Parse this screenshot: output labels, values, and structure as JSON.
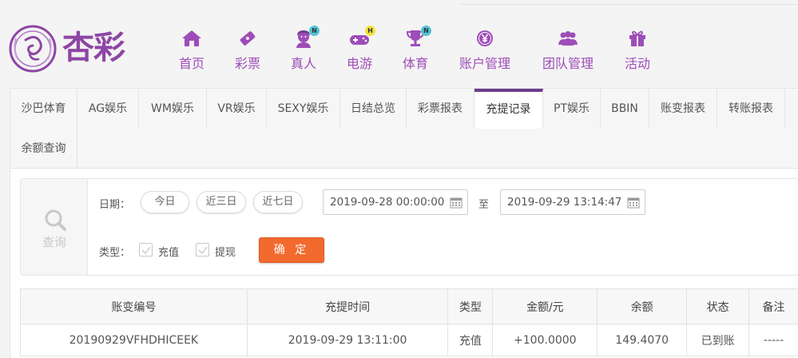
{
  "brand": {
    "name": "杏彩",
    "color": "#8e46a5"
  },
  "nav": [
    {
      "label": "首页",
      "icon": "home-icon"
    },
    {
      "label": "彩票",
      "icon": "ticket-icon"
    },
    {
      "label": "真人",
      "icon": "live-dealer-icon",
      "badge": "N"
    },
    {
      "label": "电游",
      "icon": "gamepad-icon",
      "badge": "H"
    },
    {
      "label": "体育",
      "icon": "trophy-icon",
      "badge": "N"
    },
    {
      "label": "账户管理",
      "icon": "yen-coin-icon"
    },
    {
      "label": "团队管理",
      "icon": "team-icon"
    },
    {
      "label": "活动",
      "icon": "gift-icon"
    }
  ],
  "tabs": [
    "沙巴体育",
    "AG娱乐",
    "WM娱乐",
    "VR娱乐",
    "SEXY娱乐",
    "日结总览",
    "彩票报表",
    "充提记录",
    "PT娱乐",
    "BBIN",
    "账变报表",
    "转账报表",
    "余额查询"
  ],
  "active_tab": "充提记录",
  "filter": {
    "side_label": "查询",
    "date_label": "日期：",
    "quick_ranges": [
      "今日",
      "近三日",
      "近七日"
    ],
    "start_date": "2019-09-28 00:00:00",
    "separator": "至",
    "end_date": "2019-09-29 13:14:47",
    "type_label": "类型：",
    "types": [
      {
        "label": "充值",
        "checked": false
      },
      {
        "label": "提现",
        "checked": false
      }
    ],
    "confirm_label": "确 定"
  },
  "table": {
    "headers": [
      "账变编号",
      "充提时间",
      "类型",
      "金额/元",
      "余额",
      "状态",
      "备注"
    ],
    "rows": [
      [
        "20190929VFHDHICEEK",
        "2019-09-29 13:11:00",
        "充值",
        "+100.0000",
        "149.4070",
        "已到账",
        "-----"
      ]
    ]
  },
  "colors": {
    "accent": "#9e4db8",
    "active_tab_bar": "#6d3d8a",
    "confirm": "#f26a2e",
    "positive": "#e0342a",
    "success": "#2ea12e"
  }
}
